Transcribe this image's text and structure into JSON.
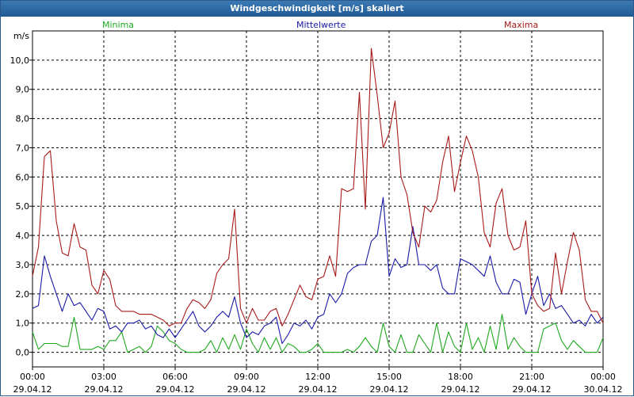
{
  "window": {
    "title": "Windgeschwindigkeit [m/s] skaliert"
  },
  "legend": [
    "Minima",
    "Mittelwerte",
    "Maxima"
  ],
  "colors": {
    "Minima": "#1fa81f",
    "Mittelwerte": "#1a1aa8",
    "Maxima": "#a81a1a",
    "grid": "#000000",
    "titlebar": "#2a6aa8"
  },
  "chart_data": {
    "type": "line",
    "title": "Windgeschwindigkeit [m/s] skaliert",
    "ylabel": "m/s",
    "ylim": [
      -0.5,
      11.0
    ],
    "yticks": [
      "0,0",
      "1,0",
      "2,0",
      "3,0",
      "4,0",
      "5,0",
      "6,0",
      "7,0",
      "8,0",
      "9,0",
      "10,0"
    ],
    "xticks": [
      {
        "time": "00:00",
        "date": "29.04.12"
      },
      {
        "time": "03:00",
        "date": "29.04.12"
      },
      {
        "time": "06:00",
        "date": "29.04.12"
      },
      {
        "time": "09:00",
        "date": "29.04.12"
      },
      {
        "time": "12:00",
        "date": "29.04.12"
      },
      {
        "time": "15:00",
        "date": "29.04.12"
      },
      {
        "time": "18:00",
        "date": "29.04.12"
      },
      {
        "time": "21:00",
        "date": "29.04.12"
      },
      {
        "time": "00:00",
        "date": "30.04.12"
      }
    ],
    "grid": true,
    "legend_position": "top",
    "x": [
      "00:00",
      "00:15",
      "00:30",
      "00:45",
      "01:00",
      "01:15",
      "01:30",
      "01:45",
      "02:00",
      "02:15",
      "02:30",
      "02:45",
      "03:00",
      "03:15",
      "03:30",
      "03:45",
      "04:00",
      "04:15",
      "04:30",
      "04:45",
      "05:00",
      "05:15",
      "05:30",
      "05:45",
      "06:00",
      "06:15",
      "06:30",
      "06:45",
      "07:00",
      "07:15",
      "07:30",
      "07:45",
      "08:00",
      "08:15",
      "08:30",
      "08:45",
      "09:00",
      "09:15",
      "09:30",
      "09:45",
      "10:00",
      "10:15",
      "10:30",
      "10:45",
      "11:00",
      "11:15",
      "11:30",
      "11:45",
      "12:00",
      "12:15",
      "12:30",
      "12:45",
      "13:00",
      "13:15",
      "13:30",
      "13:45",
      "14:00",
      "14:15",
      "14:30",
      "14:45",
      "15:00",
      "15:15",
      "15:30",
      "15:45",
      "16:00",
      "16:15",
      "16:30",
      "16:45",
      "17:00",
      "17:15",
      "17:30",
      "17:45",
      "18:00",
      "18:15",
      "18:30",
      "18:45",
      "19:00",
      "19:15",
      "19:30",
      "19:45",
      "20:00",
      "20:15",
      "20:30",
      "20:45",
      "21:00",
      "21:15",
      "21:30",
      "21:45",
      "22:00",
      "22:15",
      "22:30",
      "22:45",
      "23:00",
      "23:15",
      "23:30",
      "23:45",
      "00:00"
    ],
    "series": [
      {
        "name": "Minima",
        "values": [
          0.7,
          0.1,
          0.3,
          0.3,
          0.3,
          0.2,
          0.2,
          1.2,
          0.1,
          0.1,
          0.1,
          0.2,
          0.1,
          0.4,
          0.4,
          0.7,
          0.0,
          0.1,
          0.2,
          0.0,
          0.2,
          0.9,
          0.7,
          0.4,
          0.3,
          0.1,
          0.0,
          0.0,
          0.0,
          0.1,
          0.4,
          0.0,
          0.5,
          0.1,
          0.6,
          0.1,
          0.8,
          0.3,
          0.0,
          0.5,
          0.1,
          0.5,
          0.0,
          0.3,
          0.2,
          0.0,
          0.0,
          0.1,
          0.3,
          0.0,
          0.0,
          0.0,
          0.0,
          0.1,
          0.0,
          0.2,
          0.5,
          0.2,
          0.0,
          1.0,
          0.2,
          0.0,
          0.6,
          0.0,
          0.0,
          0.6,
          0.3,
          0.0,
          1.0,
          0.0,
          0.7,
          0.2,
          0.0,
          1.0,
          0.1,
          0.5,
          0.0,
          0.9,
          0.1,
          1.3,
          0.1,
          0.5,
          0.2,
          0.0,
          0.0,
          0.0,
          0.8,
          0.9,
          1.0,
          0.4,
          0.1,
          0.4,
          0.2,
          0.0,
          0.0,
          0.0,
          0.5
        ],
        "color": "#1fa81f"
      },
      {
        "name": "Mittelwerte",
        "values": [
          1.5,
          1.6,
          3.3,
          2.6,
          2.0,
          1.4,
          2.0,
          1.6,
          1.7,
          1.4,
          1.1,
          1.5,
          1.4,
          0.8,
          0.9,
          0.7,
          1.0,
          1.0,
          1.1,
          0.8,
          0.9,
          0.6,
          0.5,
          0.8,
          0.5,
          0.8,
          1.1,
          1.4,
          0.9,
          0.7,
          0.9,
          1.2,
          1.4,
          1.2,
          1.9,
          1.0,
          0.5,
          0.7,
          0.6,
          0.9,
          1.0,
          1.2,
          0.3,
          0.6,
          1.0,
          0.9,
          1.1,
          0.8,
          1.2,
          1.3,
          2.0,
          1.7,
          2.0,
          2.7,
          2.9,
          3.0,
          3.0,
          3.8,
          4.0,
          5.3,
          2.6,
          3.2,
          2.9,
          3.0,
          4.3,
          3.0,
          3.0,
          2.8,
          3.0,
          2.2,
          2.0,
          2.0,
          3.2,
          3.1,
          3.0,
          2.8,
          2.6,
          3.3,
          2.4,
          2.0,
          2.0,
          2.5,
          2.4,
          1.3,
          2.0,
          2.6,
          1.6,
          2.0,
          1.5,
          1.6,
          1.3,
          1.0,
          1.1,
          0.9,
          1.3,
          1.0,
          1.2
        ],
        "color": "#1a1aa8"
      },
      {
        "name": "Maxima",
        "values": [
          2.6,
          3.6,
          6.7,
          6.9,
          4.5,
          3.4,
          3.3,
          4.4,
          3.6,
          3.5,
          2.3,
          2.0,
          2.8,
          2.5,
          1.6,
          1.4,
          1.4,
          1.4,
          1.3,
          1.3,
          1.3,
          1.2,
          1.1,
          0.9,
          1.0,
          1.0,
          1.5,
          1.8,
          1.7,
          1.5,
          1.8,
          2.7,
          3.0,
          3.2,
          4.9,
          1.5,
          1.0,
          1.5,
          1.1,
          1.1,
          1.4,
          1.5,
          0.9,
          1.3,
          1.8,
          2.3,
          1.9,
          1.8,
          2.5,
          2.6,
          3.3,
          2.6,
          5.6,
          5.5,
          5.6,
          8.9,
          4.9,
          10.4,
          8.8,
          7.0,
          7.5,
          8.6,
          6.0,
          5.4,
          4.1,
          3.6,
          5.0,
          4.8,
          5.2,
          6.5,
          7.4,
          5.5,
          6.5,
          7.4,
          6.9,
          6.0,
          4.1,
          3.6,
          5.1,
          5.6,
          4.0,
          3.5,
          3.6,
          4.5,
          2.0,
          1.6,
          1.4,
          1.5,
          3.4,
          2.0,
          3.1,
          4.1,
          3.5,
          1.8,
          1.4,
          1.4,
          1.0
        ],
        "color": "#a81a1a"
      }
    ]
  }
}
